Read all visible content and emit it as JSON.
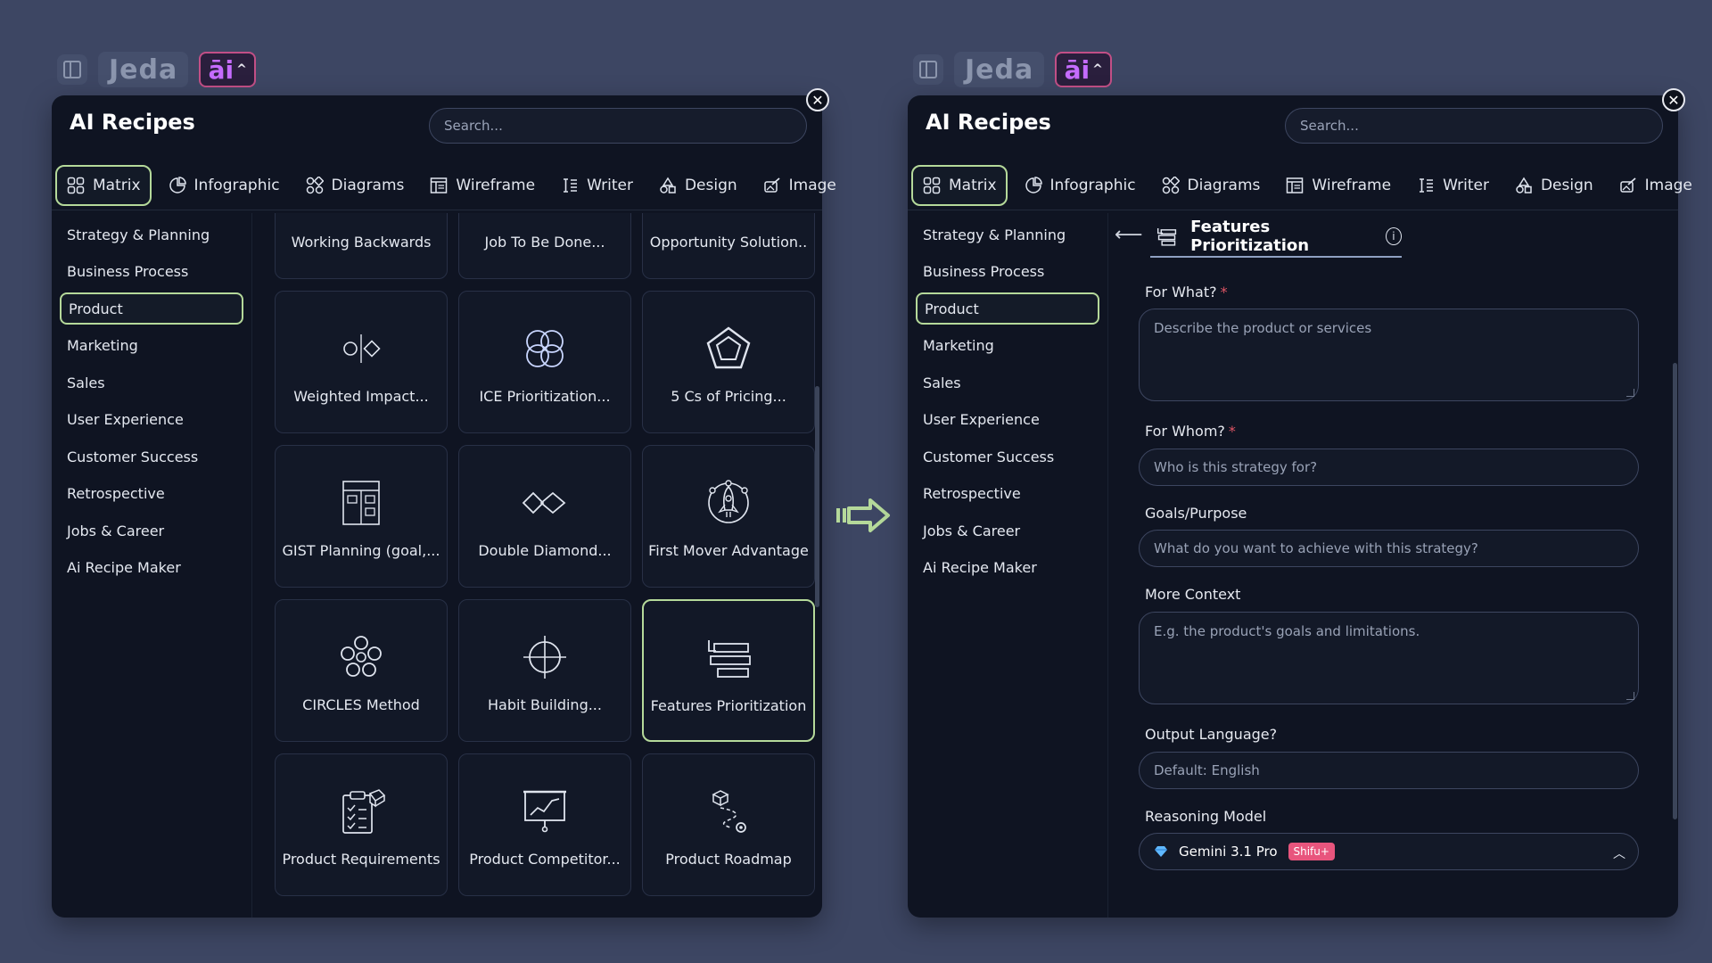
{
  "topbar": {
    "logo": "Jeda",
    "ai_label": "āi",
    "ai_chevron": "^"
  },
  "panel": {
    "title": "AI Recipes",
    "search_placeholder": "Search...",
    "close_label": "✕"
  },
  "tabs": [
    {
      "label": "Matrix",
      "icon": "matrix-icon"
    },
    {
      "label": "Infographic",
      "icon": "infographic-icon"
    },
    {
      "label": "Diagrams",
      "icon": "diagrams-icon"
    },
    {
      "label": "Wireframe",
      "icon": "wireframe-icon"
    },
    {
      "label": "Writer",
      "icon": "writer-icon"
    },
    {
      "label": "Design",
      "icon": "design-icon"
    },
    {
      "label": "Image",
      "icon": "image-icon"
    }
  ],
  "categories": [
    "Strategy & Planning",
    "Business Process",
    "Product",
    "Marketing",
    "Sales",
    "User Experience",
    "Customer Success",
    "Retrospective",
    "Jobs & Career",
    "Ai Recipe Maker"
  ],
  "active_category": "Product",
  "recipes": [
    {
      "label": "Working Backwards",
      "icon": "working-backwards-icon"
    },
    {
      "label": "Job To Be Done...",
      "icon": "jtbd-icon"
    },
    {
      "label": "Opportunity Solution..",
      "icon": "opportunity-tree-icon"
    },
    {
      "label": "Weighted Impact...",
      "icon": "weighted-impact-icon"
    },
    {
      "label": "ICE Prioritization...",
      "icon": "ice-icon"
    },
    {
      "label": "5 Cs of Pricing...",
      "icon": "pentagon-icon"
    },
    {
      "label": "GIST Planning (goal,...",
      "icon": "gist-icon"
    },
    {
      "label": "Double Diamond...",
      "icon": "double-diamond-icon"
    },
    {
      "label": "First Mover Advantage",
      "icon": "rocket-icon"
    },
    {
      "label": "CIRCLES Method",
      "icon": "circles-icon"
    },
    {
      "label": "Habit Building...",
      "icon": "crosshair-icon"
    },
    {
      "label": "Features Prioritization",
      "icon": "features-icon"
    },
    {
      "label": "Product Requirements",
      "icon": "clipboard-icon"
    },
    {
      "label": "Product Competitor...",
      "icon": "presentation-chart-icon"
    },
    {
      "label": "Product Roadmap",
      "icon": "roadmap-icon"
    }
  ],
  "selected_recipe": "Features Prioritization",
  "form": {
    "title": "Features Prioritization",
    "back_label": "⟵",
    "info_label": "i",
    "for_what": {
      "label": "For What?",
      "placeholder": "Describe the product or services"
    },
    "for_whom": {
      "label": "For Whom?",
      "placeholder": "Who is this strategy for?"
    },
    "goals": {
      "label": "Goals/Purpose",
      "placeholder": "What do you want to achieve with this strategy?"
    },
    "context": {
      "label": "More Context",
      "placeholder": "E.g. the product's goals and limitations."
    },
    "language": {
      "label": "Output Language?",
      "placeholder": "Default: English"
    },
    "model": {
      "label": "Reasoning Model",
      "value": "Gemini 3.1 Pro",
      "badge": "Shifu+"
    },
    "required_mark": "*"
  },
  "colors": {
    "background": "#3d4663",
    "panel": "#0f1422",
    "accent_green": "#b5d99a",
    "ai_magenta": "#c24f86",
    "required": "#e05565",
    "badge": "#e8557d"
  }
}
